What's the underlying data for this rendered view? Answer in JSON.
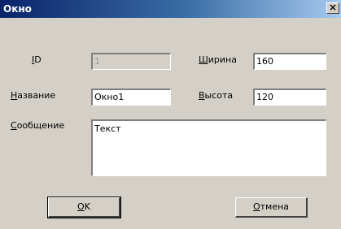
{
  "window": {
    "title": "Окно",
    "close_glyph": "×"
  },
  "form": {
    "id": {
      "label_first": "I",
      "label_rest": "D",
      "value": "1"
    },
    "name": {
      "label_first": "Н",
      "label_rest": "азвание",
      "value": "Окно1"
    },
    "message": {
      "label_first": "С",
      "label_rest": "ообщение",
      "value": "Текст"
    },
    "width": {
      "label_first": "Ш",
      "label_rest": "ирина",
      "value": "160"
    },
    "height": {
      "label_first": "В",
      "label_rest": "ысота",
      "value": "120"
    }
  },
  "buttons": {
    "ok": {
      "first": "О",
      "rest": "K"
    },
    "cancel": {
      "first": "О",
      "rest": "тмена"
    }
  }
}
